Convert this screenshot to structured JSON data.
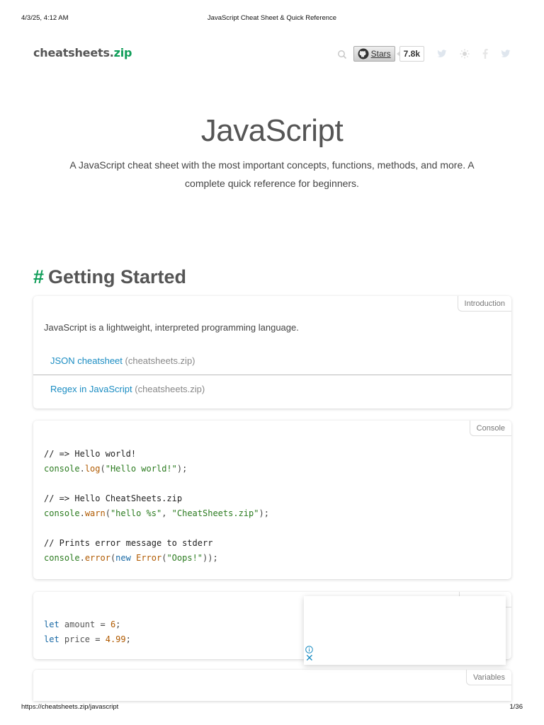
{
  "print_header": {
    "date": "4/3/25, 4:12 AM",
    "title": "JavaScript Cheat Sheet & Quick Reference"
  },
  "print_footer": {
    "url": "https://cheatsheets.zip/javascript",
    "page": "1/36"
  },
  "navbar": {
    "logo_main": "cheatsheets.",
    "logo_accent": "zip",
    "stars_label": "Stars",
    "stars_count": "7.8k",
    "icons": [
      "search-icon",
      "github-icon",
      "twitter-icon",
      "theme-toggle-icon",
      "facebook-icon",
      "twitter-share-icon"
    ]
  },
  "hero": {
    "title": "JavaScript",
    "description": "A JavaScript cheat sheet with the most important concepts, functions, methods, and more. A complete quick reference for beginners."
  },
  "section": {
    "hash": "#",
    "title": "Getting Started"
  },
  "cards": {
    "introduction": {
      "tag": "Introduction",
      "text": "JavaScript is a lightweight, interpreted programming language.",
      "links": [
        {
          "label": "JSON cheatsheet",
          "source": "(cheatsheets.zip)"
        },
        {
          "label": "Regex in JavaScript",
          "source": "(cheatsheets.zip)"
        }
      ]
    },
    "console": {
      "tag": "Console",
      "comment1": "// => Hello world!",
      "line1": {
        "obj": "console",
        "dot": ".",
        "method": "log",
        "open": "(",
        "arg": "\"Hello world!\"",
        "close": ");"
      },
      "comment2": "// => Hello CheatSheets.zip",
      "line2": {
        "obj": "console",
        "dot": ".",
        "method": "warn",
        "open": "(",
        "arg1": "\"hello %s\"",
        "comma": ", ",
        "arg2": "\"CheatSheets.zip\"",
        "close": ");"
      },
      "comment3": "// Prints error message to stderr",
      "line3": {
        "obj": "console",
        "dot": ".",
        "method": "error",
        "open": "(",
        "kw": "new",
        "space": " ",
        "cls": "Error",
        "open2": "(",
        "arg": "\"Oops!\"",
        "close": "));"
      }
    },
    "numbers": {
      "line1": {
        "kw": "let",
        "name": " amount ",
        "eq": "= ",
        "val": "6",
        "end": ";"
      },
      "line2": {
        "kw": "let",
        "name": " price ",
        "eq": "= ",
        "val": "4.99",
        "end": ";"
      }
    },
    "variables": {
      "tag": "Variables"
    }
  },
  "ad": {
    "info_icon": "info-icon",
    "close_label": "✕"
  }
}
